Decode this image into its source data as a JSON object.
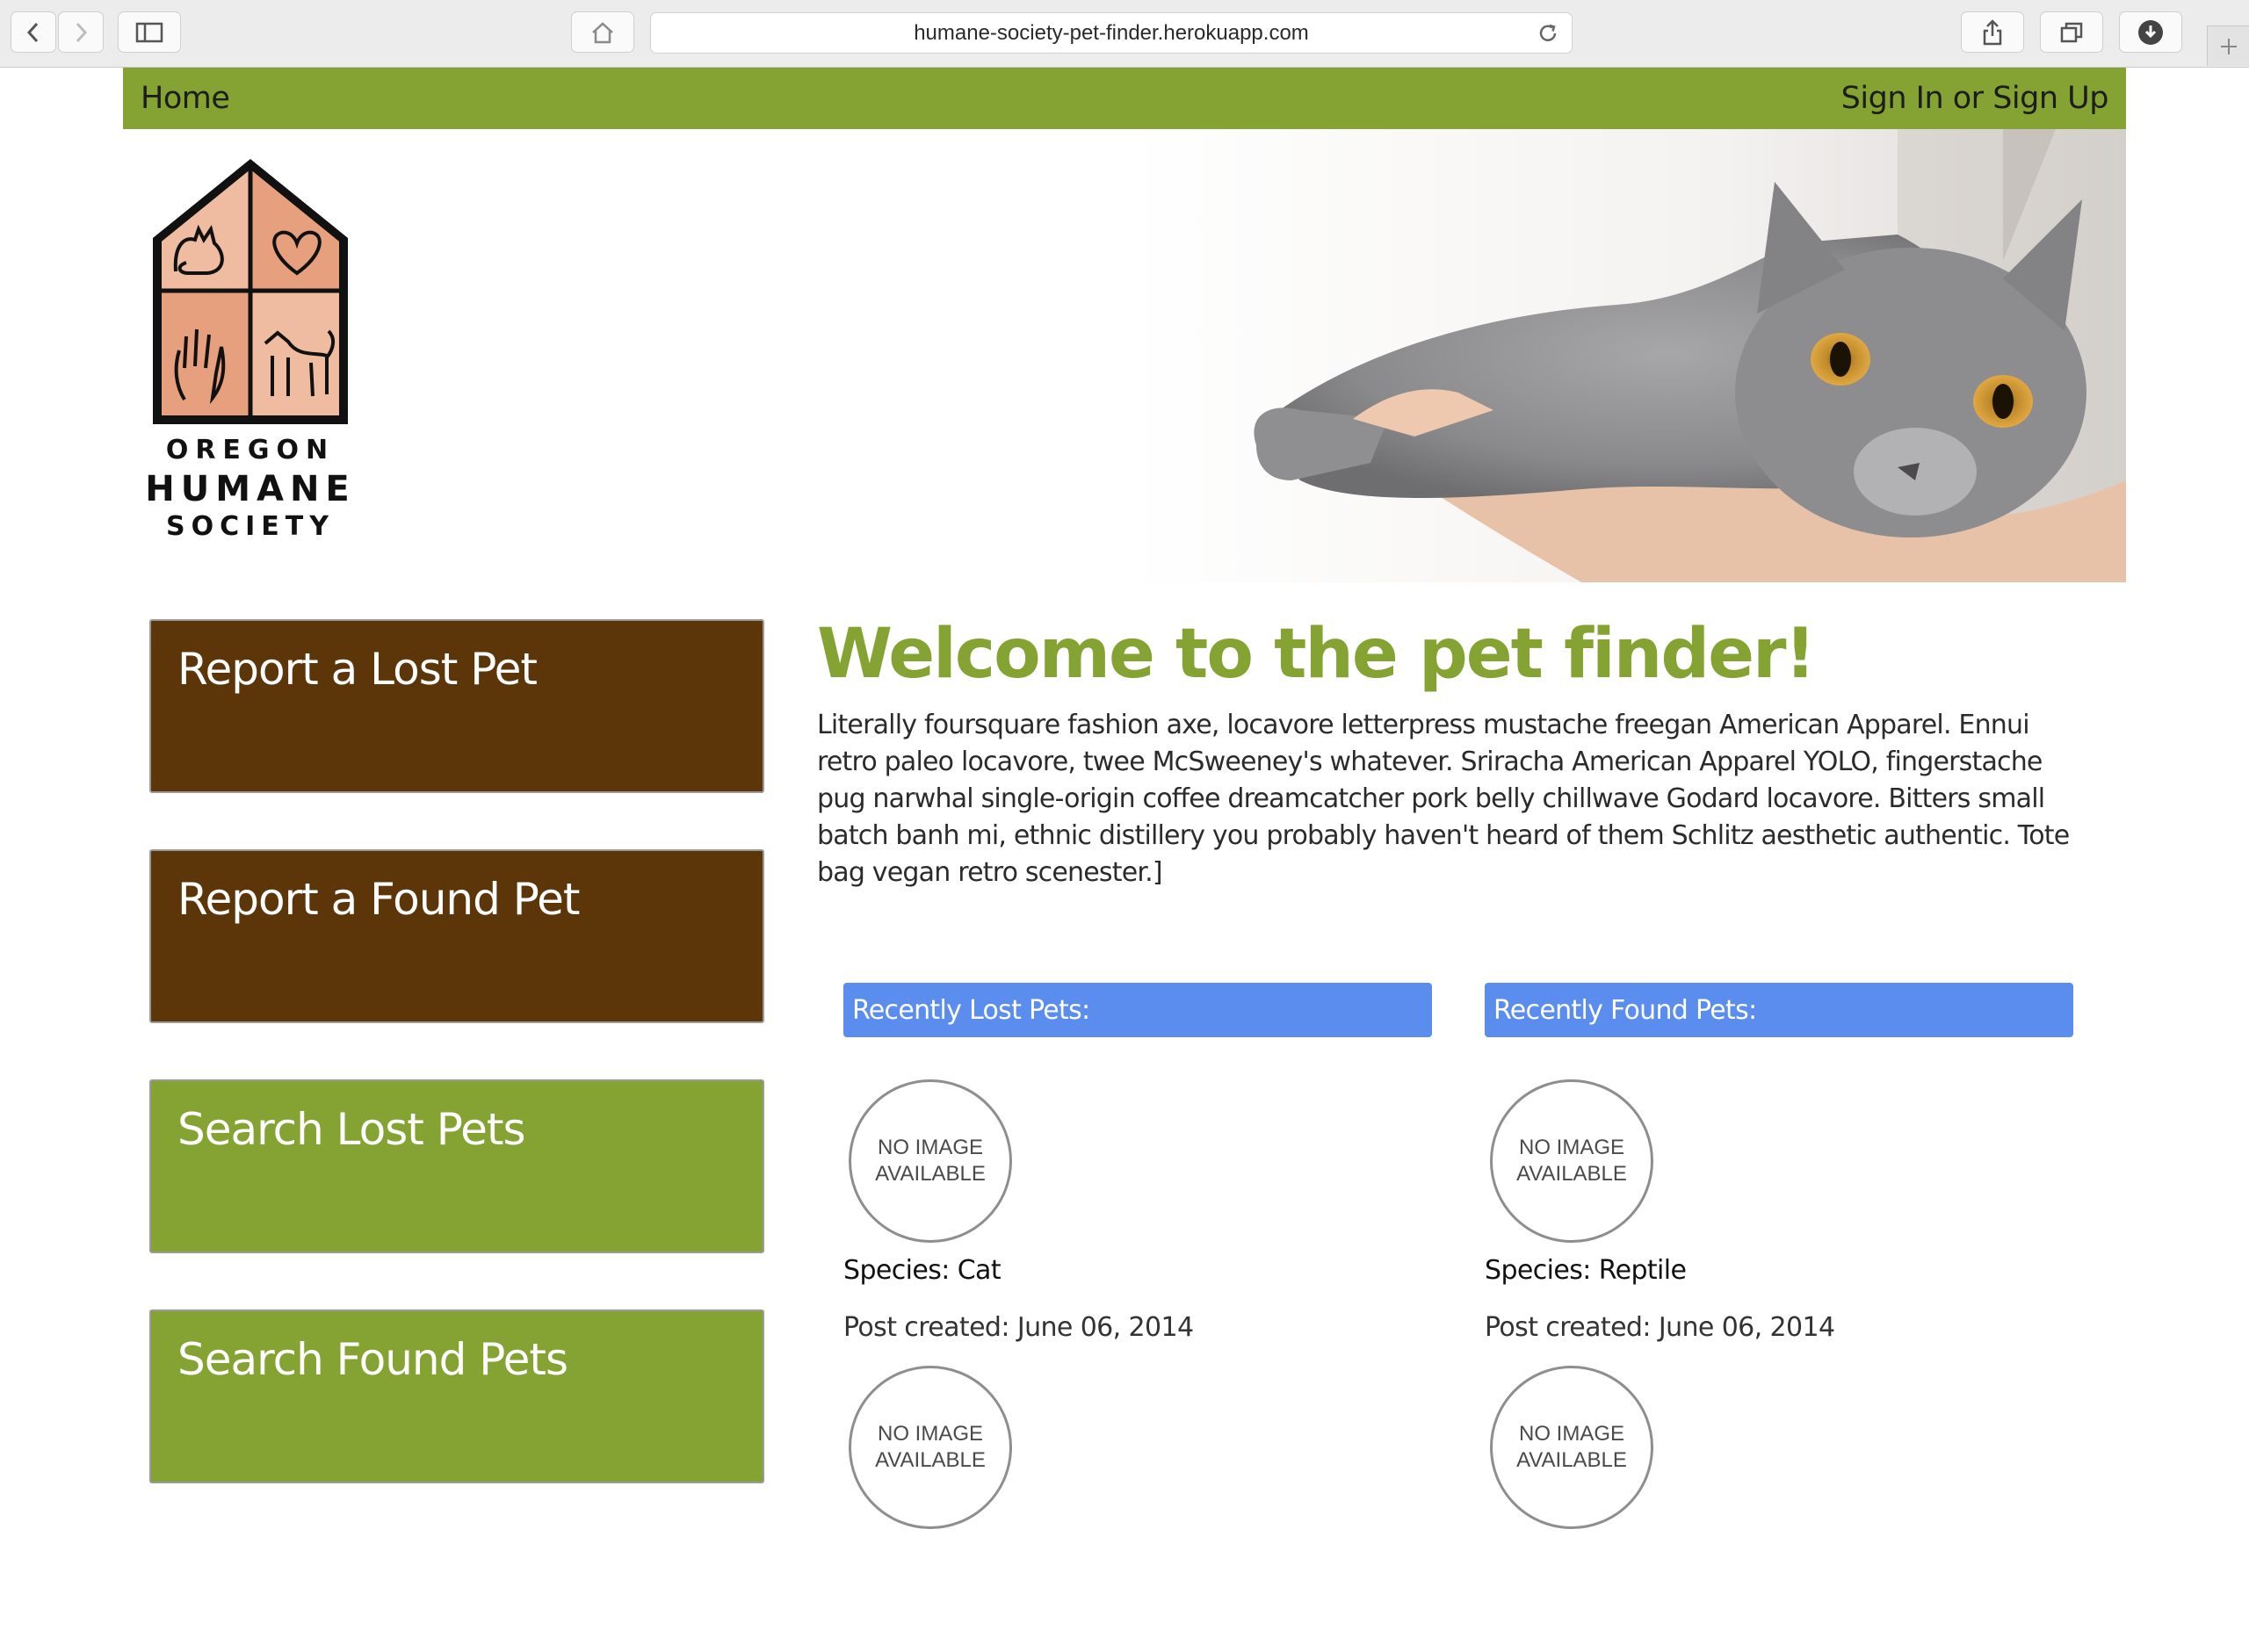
{
  "browser": {
    "url": "humane-society-pet-finder.herokuapp.com",
    "icons": [
      "back-icon",
      "forward-icon",
      "sidebar-icon",
      "home-icon",
      "reload-icon",
      "share-icon",
      "tabs-icon",
      "download-icon",
      "new-tab-icon"
    ]
  },
  "nav": {
    "home": "Home",
    "signin": "Sign In or Sign Up",
    "bg_color": "#84a332"
  },
  "logo": {
    "line1": "OREGON",
    "line2": "HUMANE",
    "line3": "SOCIETY"
  },
  "actions": [
    {
      "label": "Report a Lost Pet",
      "color": "#5c3508"
    },
    {
      "label": "Report a Found Pet",
      "color": "#5c3508"
    },
    {
      "label": "Search Lost Pets",
      "color": "#84a332"
    },
    {
      "label": "Search Found Pets",
      "color": "#84a332"
    }
  ],
  "main": {
    "title": "Welcome to the pet finder!",
    "intro": "Literally foursquare fashion axe, locavore letterpress mustache freegan American Apparel. Ennui retro paleo locavore, twee McSweeney's whatever. Sriracha American Apparel YOLO, fingerstache pug narwhal single-origin coffee dreamcatcher pork belly chillwave Godard locavore. Bitters small batch banh mi, ethnic distillery you probably haven't heard of them Schlitz aesthetic authentic. Tote bag vegan retro scenester.]"
  },
  "lost": {
    "header": "Recently Lost Pets:",
    "pets": [
      {
        "image_line1": "NO IMAGE",
        "image_line2": "AVAILABLE",
        "species": "Species: Cat",
        "date": "Post created: June 06, 2014"
      },
      {
        "image_line1": "NO IMAGE",
        "image_line2": "AVAILABLE"
      }
    ]
  },
  "found": {
    "header": "Recently Found Pets:",
    "pets": [
      {
        "image_line1": "NO IMAGE",
        "image_line2": "AVAILABLE",
        "species": "Species: Reptile",
        "date": "Post created: June 06, 2014"
      },
      {
        "image_line1": "NO IMAGE",
        "image_line2": "AVAILABLE"
      }
    ]
  },
  "colors": {
    "accent_green": "#84a332",
    "brown": "#5c3508",
    "header_blue": "#5a8dee"
  }
}
